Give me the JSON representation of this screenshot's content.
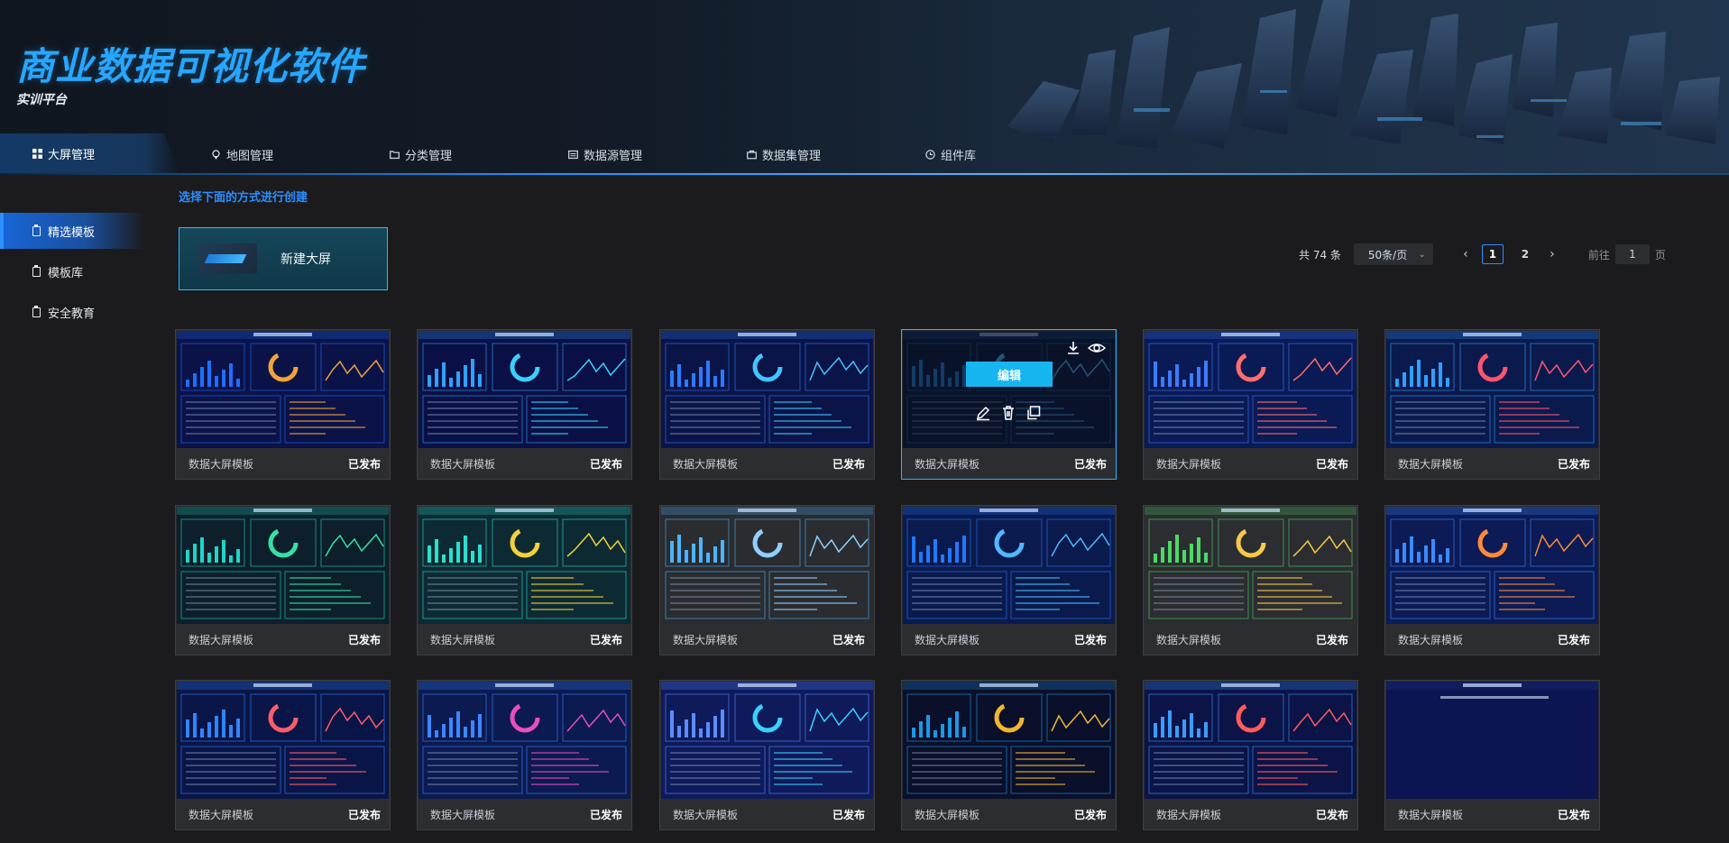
{
  "brand": {
    "title": "商业数据可视化软件",
    "subtitle": "实训平台"
  },
  "nav": {
    "items": [
      {
        "label": "大屏管理",
        "icon": "grid-icon"
      },
      {
        "label": "地图管理",
        "icon": "map-pin-icon"
      },
      {
        "label": "分类管理",
        "icon": "folder-icon"
      },
      {
        "label": "数据源管理",
        "icon": "database-icon"
      },
      {
        "label": "数据集管理",
        "icon": "briefcase-icon"
      },
      {
        "label": "组件库",
        "icon": "component-icon"
      }
    ],
    "active": 0
  },
  "sidebar": {
    "items": [
      {
        "label": "精选模板",
        "icon": "clipboard-icon"
      },
      {
        "label": "模板库",
        "icon": "clipboard-icon"
      },
      {
        "label": "安全教育",
        "icon": "clipboard-icon"
      }
    ],
    "active": 0
  },
  "main": {
    "hint": "选择下面的方式进行创建",
    "new_button": "新建大屏"
  },
  "pager": {
    "total": "共 74 条",
    "page_size": "50条/页",
    "pages": [
      "1",
      "2"
    ],
    "current": "1",
    "goto_prefix": "前往",
    "goto_value": "1",
    "goto_suffix": "页"
  },
  "overlay": {
    "edit_label": "编辑"
  },
  "cards": [
    {
      "name": "数据大屏模板",
      "status": "已发布"
    },
    {
      "name": "数据大屏模板",
      "status": "已发布"
    },
    {
      "name": "数据大屏模板",
      "status": "已发布"
    },
    {
      "name": "数据大屏模板",
      "status": "已发布"
    },
    {
      "name": "数据大屏模板",
      "status": "已发布"
    },
    {
      "name": "数据大屏模板",
      "status": "已发布"
    },
    {
      "name": "数据大屏模板",
      "status": "已发布"
    },
    {
      "name": "数据大屏模板",
      "status": "已发布"
    },
    {
      "name": "数据大屏模板",
      "status": "已发布"
    },
    {
      "name": "数据大屏模板",
      "status": "已发布"
    },
    {
      "name": "数据大屏模板",
      "status": "已发布"
    },
    {
      "name": "数据大屏模板",
      "status": "已发布"
    },
    {
      "name": "数据大屏模板",
      "status": "已发布"
    },
    {
      "name": "数据大屏模板",
      "status": "已发布"
    },
    {
      "name": "数据大屏模板",
      "status": "已发布"
    },
    {
      "name": "数据大屏模板",
      "status": "已发布"
    },
    {
      "name": "数据大屏模板",
      "status": "已发布"
    },
    {
      "name": "数据大屏模板",
      "status": "已发布"
    }
  ],
  "colors": {
    "accent": "#2c8fff",
    "highlight": "#17b6f0",
    "card_bg": "#2b2d30",
    "page_bg": "#1b1b1d"
  }
}
